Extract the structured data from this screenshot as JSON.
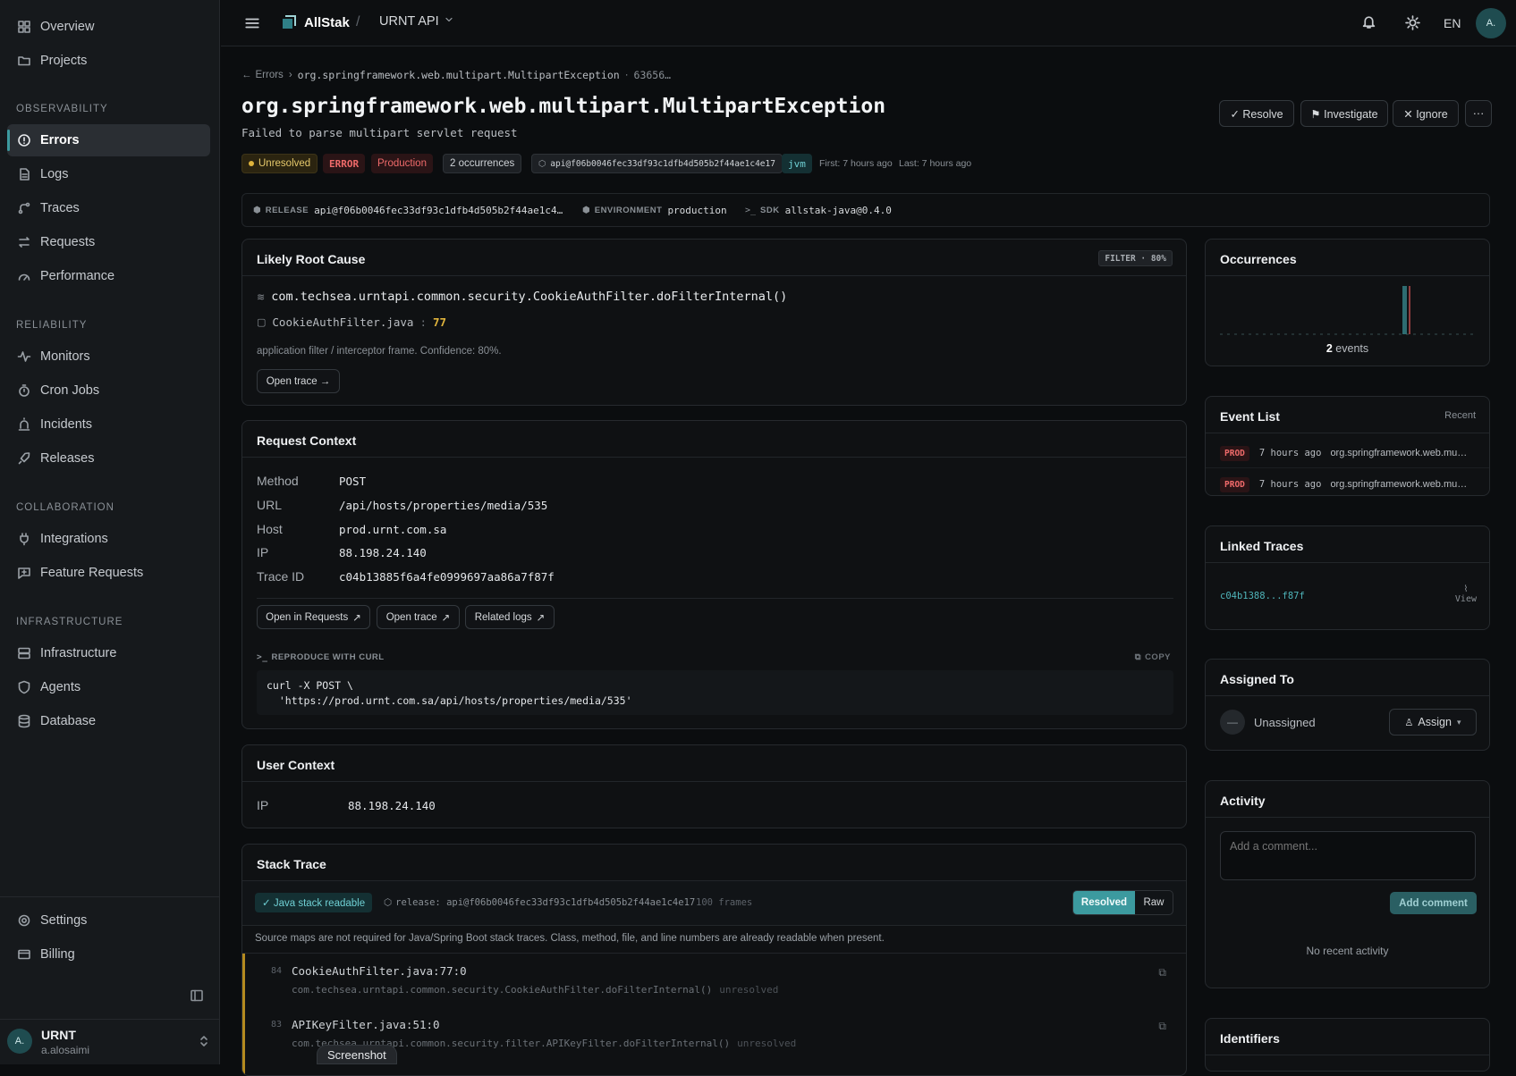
{
  "sidebar": {
    "overview": "Overview",
    "projects": "Projects",
    "sections": {
      "observability": "OBSERVABILITY",
      "reliability": "RELIABILITY",
      "collaboration": "COLLABORATION",
      "infrastructure": "INFRASTRUCTURE"
    },
    "observability": [
      "Errors",
      "Logs",
      "Traces",
      "Requests",
      "Performance"
    ],
    "reliability": [
      "Monitors",
      "Cron Jobs",
      "Incidents",
      "Releases"
    ],
    "collaboration": [
      "Integrations",
      "Feature Requests"
    ],
    "infrastructure": [
      "Infrastructure",
      "Agents",
      "Database"
    ],
    "settings": "Settings",
    "billing": "Billing",
    "user": {
      "avatar": "A.",
      "org": "URNT",
      "handle": "a.alosaimi"
    }
  },
  "topbar": {
    "brand": "AllStak",
    "separator": "/",
    "project": "URNT API",
    "lang": "EN",
    "avatar": "A."
  },
  "breadcrumb": {
    "back": "Errors",
    "sep": "›",
    "exception": "org.springframework.web.multipart.MultipartException",
    "dot": "·",
    "id": "63656…"
  },
  "error": {
    "title": "org.springframework.web.multipart.MultipartException",
    "message": "Failed to parse multipart servlet request",
    "status": "Unresolved",
    "level": "ERROR",
    "env": "Production",
    "occurrences": "2 occurrences",
    "release_tag": "api@f06b0046fec33df93c1dfb4d505b2f44ae1c4e17",
    "platform": "jvm",
    "first": "First: 7 hours ago",
    "last": "Last: 7 hours ago"
  },
  "actions": {
    "resolve": "✓ Resolve",
    "investigate": "⚑ Investigate",
    "ignore": "✕ Ignore",
    "more": "···"
  },
  "meta": {
    "release_label": "RELEASE",
    "release_value": "api@f06b0046fec33df93c1dfb4d505b2f44ae1c4…",
    "env_label": "ENVIRONMENT",
    "env_value": "production",
    "sdk_label": "SDK",
    "sdk_value": "allstak-java@0.4.0"
  },
  "root_cause": {
    "title": "Likely Root Cause",
    "badge": "FILTER · 80%",
    "method": "com.techsea.urntapi.common.security.CookieAuthFilter.doFilterInternal()",
    "file": "CookieAuthFilter.java",
    "colon": ":",
    "line": "77",
    "note": "application filter / interceptor frame. Confidence: 80%.",
    "button": "Open trace →"
  },
  "request": {
    "title": "Request Context",
    "rows": [
      {
        "k": "Method",
        "v": "POST"
      },
      {
        "k": "URL",
        "v": "/api/hosts/properties/media/535"
      },
      {
        "k": "Host",
        "v": "prod.urnt.com.sa"
      },
      {
        "k": "IP",
        "v": "88.198.24.140"
      },
      {
        "k": "Trace ID",
        "v": "c04b13885f6a4fe0999697aa86a7f87f"
      }
    ],
    "buttons": [
      "Open in Requests",
      "Open trace",
      "Related logs"
    ],
    "curl_label": "REPRODUCE WITH CURL",
    "copy": "COPY",
    "curl_line1": "curl -X POST \\",
    "curl_line2": "  'https://prod.urnt.com.sa/api/hosts/properties/media/535'"
  },
  "user_ctx": {
    "title": "User Context",
    "ip_label": "IP",
    "ip": "88.198.24.140"
  },
  "stack": {
    "title": "Stack Trace",
    "readable": "✓ Java stack readable",
    "release": "release: api@f06b0046fec33df93c1dfb4d505b2f44ae1c4e17",
    "frames": "100 frames",
    "tab_resolved": "Resolved",
    "tab_raw": "Raw",
    "info": "Source maps are not required for Java/Spring Boot stack traces. Class, method, file, and line numbers are already readable when present.",
    "items": [
      {
        "num": "84",
        "file": "CookieAuthFilter.java:77:0",
        "method": "com.techsea.urntapi.common.security.CookieAuthFilter.doFilterInternal()",
        "state": "unresolved"
      },
      {
        "num": "83",
        "file": "APIKeyFilter.java:51:0",
        "method": "com.techsea.urntapi.common.security.filter.APIKeyFilter.doFilterInternal()",
        "state": "unresolved"
      }
    ]
  },
  "occurrences": {
    "title": "Occurrences",
    "count": "2",
    "unit": "events"
  },
  "chart_data": {
    "type": "bar",
    "title": "Occurrences",
    "values": [
      0,
      0,
      0,
      0,
      0,
      0,
      0,
      0,
      0,
      0,
      0,
      0,
      0,
      0,
      0,
      0,
      0,
      0,
      0,
      0,
      0,
      0,
      0,
      0,
      0,
      0,
      0,
      0,
      0,
      2,
      0,
      0,
      0,
      0,
      0,
      0,
      0,
      0,
      0,
      0,
      0
    ]
  },
  "events": {
    "title": "Event List",
    "recent": "Recent",
    "items": [
      {
        "env": "PROD",
        "time": "7 hours ago",
        "msg": "org.springframework.web.mu…"
      },
      {
        "env": "PROD",
        "time": "7 hours ago",
        "msg": "org.springframework.web.mu…"
      }
    ]
  },
  "linked": {
    "title": "Linked Traces",
    "trace": "c04b1388...f87f",
    "view": "View"
  },
  "assigned": {
    "title": "Assigned To",
    "avatar": "—",
    "name": "Unassigned",
    "button": "Assign"
  },
  "activity": {
    "title": "Activity",
    "placeholder": "Add a comment...",
    "button": "Add comment",
    "empty": "No recent activity"
  },
  "identifiers": {
    "title": "Identifiers"
  },
  "overlay": {
    "screenshot": "Screenshot"
  },
  "colors": {
    "accent": "#3c9a9f",
    "error": "#e25b5b",
    "warning": "#e0b43c"
  }
}
